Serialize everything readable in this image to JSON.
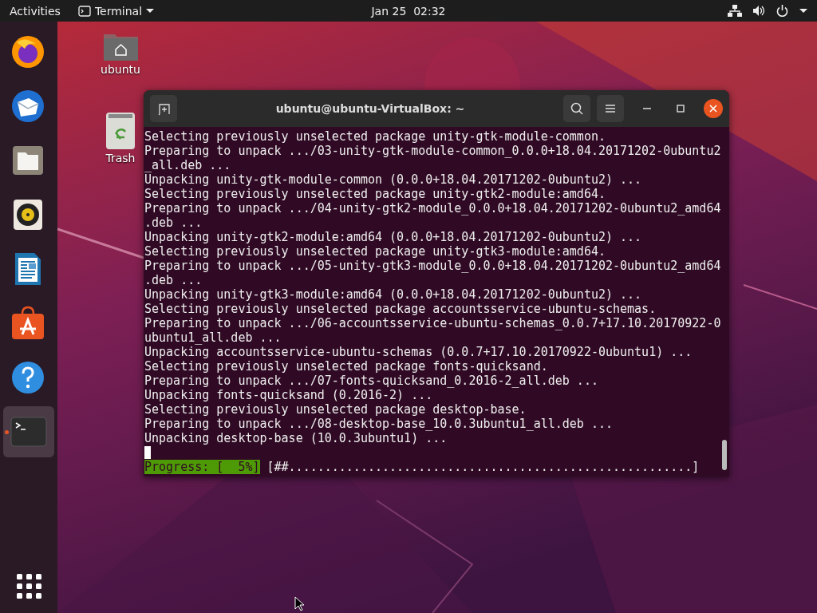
{
  "top_bar": {
    "activities": "Activities",
    "app_menu": "Terminal",
    "clock": "Jan 25  02:32"
  },
  "dock": {
    "items": [
      {
        "kind": "browser",
        "running": false
      },
      {
        "kind": "mail",
        "running": false
      },
      {
        "kind": "files",
        "running": false
      },
      {
        "kind": "music",
        "running": false
      },
      {
        "kind": "writer",
        "running": false
      },
      {
        "kind": "software",
        "running": false
      },
      {
        "kind": "help",
        "running": false
      },
      {
        "kind": "terminal",
        "running": true
      }
    ]
  },
  "desktop_icons": [
    {
      "kind": "home",
      "label": "ubuntu"
    },
    {
      "kind": "trash",
      "label": "Trash"
    }
  ],
  "terminal": {
    "title": "ubuntu@ubuntu-VirtualBox: ~",
    "lines": [
      "Selecting previously unselected package unity-gtk-module-common.",
      "Preparing to unpack .../03-unity-gtk-module-common_0.0.0+18.04.20171202-0ubuntu2",
      "_all.deb ...",
      "Unpacking unity-gtk-module-common (0.0.0+18.04.20171202-0ubuntu2) ...",
      "Selecting previously unselected package unity-gtk2-module:amd64.",
      "Preparing to unpack .../04-unity-gtk2-module_0.0.0+18.04.20171202-0ubuntu2_amd64",
      ".deb ...",
      "Unpacking unity-gtk2-module:amd64 (0.0.0+18.04.20171202-0ubuntu2) ...",
      "Selecting previously unselected package unity-gtk3-module:amd64.",
      "Preparing to unpack .../05-unity-gtk3-module_0.0.0+18.04.20171202-0ubuntu2_amd64",
      ".deb ...",
      "Unpacking unity-gtk3-module:amd64 (0.0.0+18.04.20171202-0ubuntu2) ...",
      "Selecting previously unselected package accountsservice-ubuntu-schemas.",
      "Preparing to unpack .../06-accountsservice-ubuntu-schemas_0.0.7+17.10.20170922-0",
      "ubuntu1_all.deb ...",
      "Unpacking accountsservice-ubuntu-schemas (0.0.7+17.10.20170922-0ubuntu1) ...",
      "Selecting previously unselected package fonts-quicksand.",
      "Preparing to unpack .../07-fonts-quicksand_0.2016-2_all.deb ...",
      "Unpacking fonts-quicksand (0.2016-2) ...",
      "Selecting previously unselected package desktop-base.",
      "Preparing to unpack .../08-desktop-base_10.0.3ubuntu1_all.deb ...",
      "Unpacking desktop-base (10.0.3ubuntu1) ..."
    ],
    "progress": {
      "label": "Progress: [  5%]",
      "bar": "[##........................................................]"
    }
  }
}
